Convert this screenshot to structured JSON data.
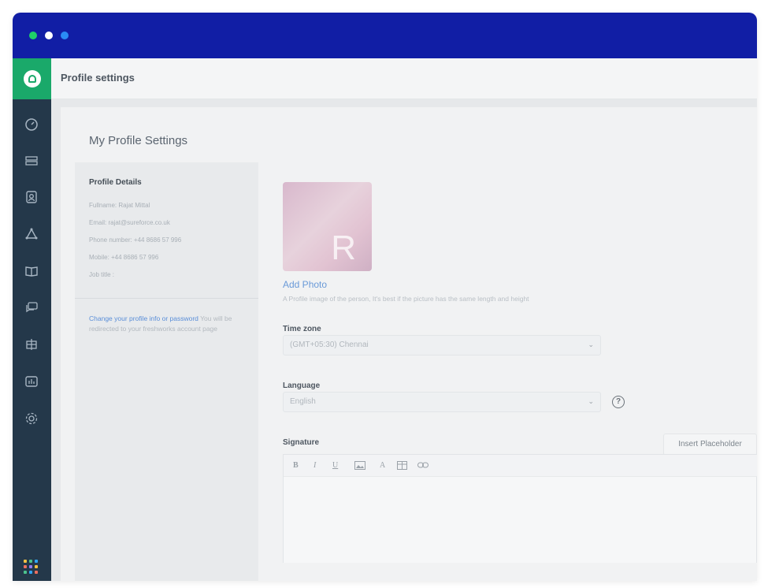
{
  "window": {
    "traffic_lights": [
      "#1fd068",
      "#ffffff",
      "#2a8cf5"
    ],
    "titlebar_color": "#111ea5"
  },
  "sidebar": {
    "logo_icon": "freshdesk-logo-icon",
    "items": [
      {
        "icon": "dashboard-icon"
      },
      {
        "icon": "tickets-icon"
      },
      {
        "icon": "contacts-icon"
      },
      {
        "icon": "groups-icon"
      },
      {
        "icon": "solutions-book-icon"
      },
      {
        "icon": "forums-icon"
      },
      {
        "icon": "reports-icon"
      },
      {
        "icon": "analytics-icon"
      },
      {
        "icon": "admin-gear-icon"
      }
    ],
    "apps_icon": "apps-grid-icon"
  },
  "topbar": {
    "title": "Profile settings"
  },
  "page": {
    "title": "My Profile Settings",
    "profile_details": {
      "heading": "Profile Details",
      "lines": [
        "Fullname: Rajat Mittal",
        "Email: rajat@sureforce.co.uk",
        "Phone number: +44 8686 57 996",
        "Mobile: +44 8686 57 996",
        "Job title :"
      ],
      "note_link": "Change your profile info or password",
      "note_text": " You will be redirected to your freshworks account page"
    },
    "photo": {
      "letter": "R",
      "add_label": "Add Photo",
      "hint": "A Profile image of the person, It's best if the picture has the same length and height"
    },
    "timezone": {
      "label": "Time zone",
      "value": "(GMT+05:30) Chennai"
    },
    "language": {
      "label": "Language",
      "value": "English"
    },
    "signature": {
      "label": "Signature",
      "insert_placeholder": "Insert Placeholder",
      "toolbar": [
        "B",
        "I",
        "U",
        "image",
        "A",
        "table",
        "link"
      ]
    }
  }
}
